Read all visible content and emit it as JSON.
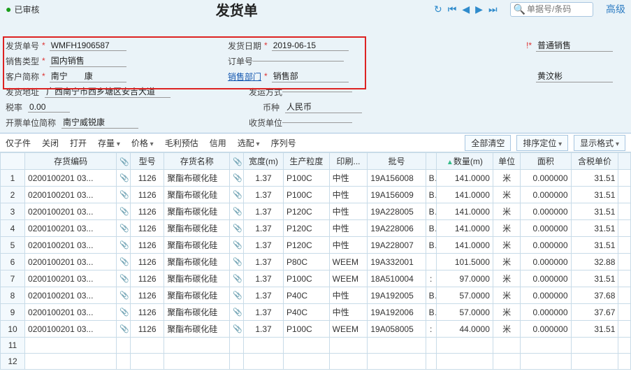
{
  "topbar": {
    "status": "已审核",
    "title": "发货单",
    "search_placeholder": "单据号/条码",
    "advanced": "高级"
  },
  "form": {
    "labels": {
      "ship_no": "发货单号",
      "ship_date": "发货日期",
      "biz_type_right": "普通销售",
      "sale_type": "销售类型",
      "order_no": "订单号",
      "cust": "客户简称",
      "sales_dept": "销售部门",
      "salesperson": "黄汶彬",
      "ship_addr": "发货地址",
      "ship_method": "发运方式",
      "tax": "税率",
      "currency_label": "币种",
      "currency": "人民币",
      "invoice_unit": "开票单位简称",
      "recv_unit": "收货单位"
    },
    "values": {
      "ship_no": "WMFH1906587",
      "ship_date": "2019-06-15",
      "sale_type": "国内销售",
      "cust": "南宁　　康",
      "sales_dept": "销售部",
      "ship_addr": "广西南宁市西乡塘区安吉大道",
      "tax": "0.00",
      "invoice_unit": "南宁威锐康"
    }
  },
  "toolbar": {
    "items": [
      "仅子件",
      "关闭",
      "打开",
      "存量",
      "价格",
      "毛利预估",
      "信用",
      "选配",
      "序列号"
    ],
    "clear_all": "全部清空",
    "sort_pos": "排序定位",
    "display_fmt": "显示格式"
  },
  "grid": {
    "headers": [
      "",
      "存货编码",
      "",
      "型号",
      "存货名称",
      "",
      "宽度(m)",
      "生产粒度",
      "印刷...",
      "批号",
      "",
      "数量(m)",
      "单位",
      "面积",
      "含税单价",
      ""
    ],
    "rows": [
      {
        "n": "1",
        "code": "0200100201 03...",
        "model": "1126",
        "name": "聚酯布碳化硅",
        "width": "1.37",
        "grade": "P100C",
        "print": "中性",
        "batch": "19A156008",
        "b2": "B",
        "qty": "141.0000",
        "unit": "米",
        "area": "0.000000",
        "price": "31.51"
      },
      {
        "n": "2",
        "code": "0200100201 03...",
        "model": "1126",
        "name": "聚酯布碳化硅",
        "width": "1.37",
        "grade": "P100C",
        "print": "中性",
        "batch": "19A156009",
        "b2": "B",
        "qty": "141.0000",
        "unit": "米",
        "area": "0.000000",
        "price": "31.51"
      },
      {
        "n": "3",
        "code": "0200100201 03...",
        "model": "1126",
        "name": "聚酯布碳化硅",
        "width": "1.37",
        "grade": "P120C",
        "print": "中性",
        "batch": "19A228005",
        "b2": "B",
        "qty": "141.0000",
        "unit": "米",
        "area": "0.000000",
        "price": "31.51"
      },
      {
        "n": "4",
        "code": "0200100201 03...",
        "model": "1126",
        "name": "聚酯布碳化硅",
        "width": "1.37",
        "grade": "P120C",
        "print": "中性",
        "batch": "19A228006",
        "b2": "B",
        "qty": "141.0000",
        "unit": "米",
        "area": "0.000000",
        "price": "31.51"
      },
      {
        "n": "5",
        "code": "0200100201 03...",
        "model": "1126",
        "name": "聚酯布碳化硅",
        "width": "1.37",
        "grade": "P120C",
        "print": "中性",
        "batch": "19A228007",
        "b2": "B",
        "qty": "141.0000",
        "unit": "米",
        "area": "0.000000",
        "price": "31.51"
      },
      {
        "n": "6",
        "code": "0200100201 03...",
        "model": "1126",
        "name": "聚酯布碳化硅",
        "width": "1.37",
        "grade": "P80C",
        "print": "WEEM",
        "batch": "19A332001",
        "b2": "",
        "qty": "101.5000",
        "unit": "米",
        "area": "0.000000",
        "price": "32.88"
      },
      {
        "n": "7",
        "code": "0200100201 03...",
        "model": "1126",
        "name": "聚酯布碳化硅",
        "width": "1.37",
        "grade": "P100C",
        "print": "WEEM",
        "batch": "18A510004",
        "b2": ":",
        "qty": "97.0000",
        "unit": "米",
        "area": "0.000000",
        "price": "31.51"
      },
      {
        "n": "8",
        "code": "0200100201 03...",
        "model": "1126",
        "name": "聚酯布碳化硅",
        "width": "1.37",
        "grade": "P40C",
        "print": "中性",
        "batch": "19A192005",
        "b2": "B",
        "qty": "57.0000",
        "unit": "米",
        "area": "0.000000",
        "price": "37.68"
      },
      {
        "n": "9",
        "code": "0200100201 03...",
        "model": "1126",
        "name": "聚酯布碳化硅",
        "width": "1.37",
        "grade": "P40C",
        "print": "中性",
        "batch": "19A192006",
        "b2": "B",
        "qty": "57.0000",
        "unit": "米",
        "area": "0.000000",
        "price": "37.67"
      },
      {
        "n": "10",
        "code": "0200100201 03...",
        "model": "1126",
        "name": "聚酯布碳化硅",
        "width": "1.37",
        "grade": "P100C",
        "print": "WEEM",
        "batch": "19A058005",
        "b2": ":",
        "qty": "44.0000",
        "unit": "米",
        "area": "0.000000",
        "price": "31.51"
      },
      {
        "n": "11",
        "code": "",
        "model": "",
        "name": "",
        "width": "",
        "grade": "",
        "print": "",
        "batch": "",
        "b2": "",
        "qty": "",
        "unit": "",
        "area": "",
        "price": ""
      },
      {
        "n": "12",
        "code": "",
        "model": "",
        "name": "",
        "width": "",
        "grade": "",
        "print": "",
        "batch": "",
        "b2": "",
        "qty": "",
        "unit": "",
        "area": "",
        "price": ""
      }
    ]
  }
}
